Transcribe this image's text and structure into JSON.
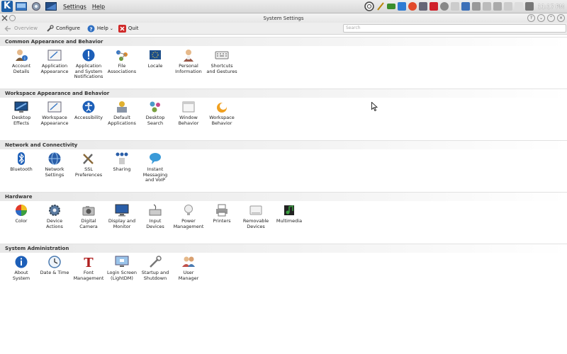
{
  "panel": {
    "menus": [
      "Settings",
      "Help"
    ],
    "clock": "11:17 PM"
  },
  "window": {
    "title": "System Settings"
  },
  "toolbar": {
    "overview": "Overview",
    "configure": "Configure",
    "help": "Help",
    "quit": "Quit",
    "search_placeholder": "Search"
  },
  "sections": [
    {
      "title": "Common Appearance and Behavior",
      "items": [
        "Account\nDetails",
        "Application\nAppearance",
        "Application\nand System\nNotifications",
        "File\nAssociations",
        "Locale",
        "Personal\nInformation",
        "Shortcuts\nand Gestures"
      ]
    },
    {
      "title": "Workspace Appearance and Behavior",
      "items": [
        "Desktop\nEffects",
        "Workspace\nAppearance",
        "Accessibility",
        "Default\nApplications",
        "Desktop\nSearch",
        "Window\nBehavior",
        "Workspace\nBehavior"
      ]
    },
    {
      "title": "Network and Connectivity",
      "items": [
        "Bluetooth",
        "Network\nSettings",
        "SSL\nPreferences",
        "Sharing",
        "Instant\nMessaging\nand VoIP"
      ]
    },
    {
      "title": "Hardware",
      "items": [
        "Color",
        "Device\nActions",
        "Digital\nCamera",
        "Display and\nMonitor",
        "Input\nDevices",
        "Power\nManagement",
        "Printers",
        "Removable\nDevices",
        "Multimedia"
      ]
    },
    {
      "title": "System Administration",
      "items": [
        "About\nSystem",
        "Date & Time",
        "Font\nManagement",
        "Login Screen\n(LightDM)",
        "Startup and\nShutdown",
        "User\nManager"
      ]
    }
  ]
}
